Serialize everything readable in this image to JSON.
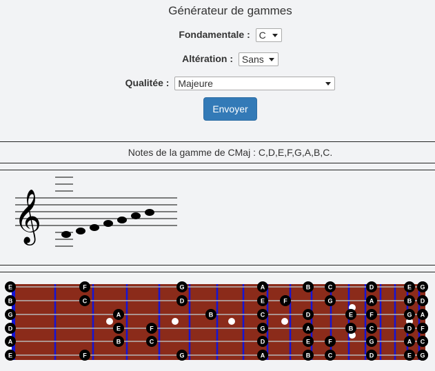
{
  "title": "Générateur de gammes",
  "form": {
    "root": {
      "label": "Fondamentale :",
      "value": "C"
    },
    "alteration": {
      "label": "Altération :",
      "value": "Sans"
    },
    "quality": {
      "label": "Qualitée :",
      "value": "Majeure"
    },
    "submit_label": "Envoyer"
  },
  "result_text": "Notes de la gamme de CMaj : C,D,E,F,G,A,B,C.",
  "fretboard": {
    "strings": [
      {
        "open": "E",
        "notes": [
          [
            2,
            "F"
          ],
          [
            5,
            "G"
          ],
          [
            8,
            "A"
          ],
          [
            10,
            "B"
          ],
          [
            11,
            "C"
          ],
          [
            13,
            "D"
          ],
          [
            15,
            "E"
          ],
          [
            16,
            "F"
          ],
          [
            18,
            "G"
          ]
        ]
      },
      {
        "open": "B",
        "notes": [
          [
            2,
            "C"
          ],
          [
            5,
            "D"
          ],
          [
            8,
            "E"
          ],
          [
            9,
            "F"
          ],
          [
            11,
            "G"
          ],
          [
            13,
            "A"
          ],
          [
            15,
            "B"
          ],
          [
            16,
            "C"
          ],
          [
            18,
            "D"
          ]
        ]
      },
      {
        "open": "G",
        "notes": [
          [
            3,
            "A"
          ],
          [
            6,
            "B"
          ],
          [
            8,
            "C"
          ],
          [
            10,
            "D"
          ],
          [
            12,
            "E"
          ],
          [
            13,
            "F"
          ],
          [
            15,
            "G"
          ],
          [
            17,
            "A"
          ]
        ]
      },
      {
        "open": "D",
        "notes": [
          [
            3,
            "E"
          ],
          [
            4,
            "F"
          ],
          [
            8,
            "G"
          ],
          [
            10,
            "A"
          ],
          [
            12,
            "B"
          ],
          [
            13,
            "C"
          ],
          [
            15,
            "D"
          ],
          [
            17,
            "E"
          ],
          [
            18,
            "F"
          ]
        ]
      },
      {
        "open": "A",
        "notes": [
          [
            3,
            "B"
          ],
          [
            4,
            "C"
          ],
          [
            8,
            "D"
          ],
          [
            10,
            "E"
          ],
          [
            11,
            "F"
          ],
          [
            13,
            "G"
          ],
          [
            15,
            "A"
          ],
          [
            17,
            "B"
          ],
          [
            18,
            "C"
          ]
        ]
      },
      {
        "open": "E",
        "notes": [
          [
            2,
            "F"
          ],
          [
            5,
            "G"
          ],
          [
            8,
            "A"
          ],
          [
            10,
            "B"
          ],
          [
            11,
            "C"
          ],
          [
            13,
            "D"
          ],
          [
            15,
            "E"
          ],
          [
            16,
            "F"
          ],
          [
            18,
            "G"
          ]
        ]
      }
    ],
    "colors": {
      "wood": "#8b2b1a",
      "fret": "#1515d6",
      "string": "#b8b8b8",
      "note": "#000000",
      "note_text": "#ffffff"
    }
  }
}
